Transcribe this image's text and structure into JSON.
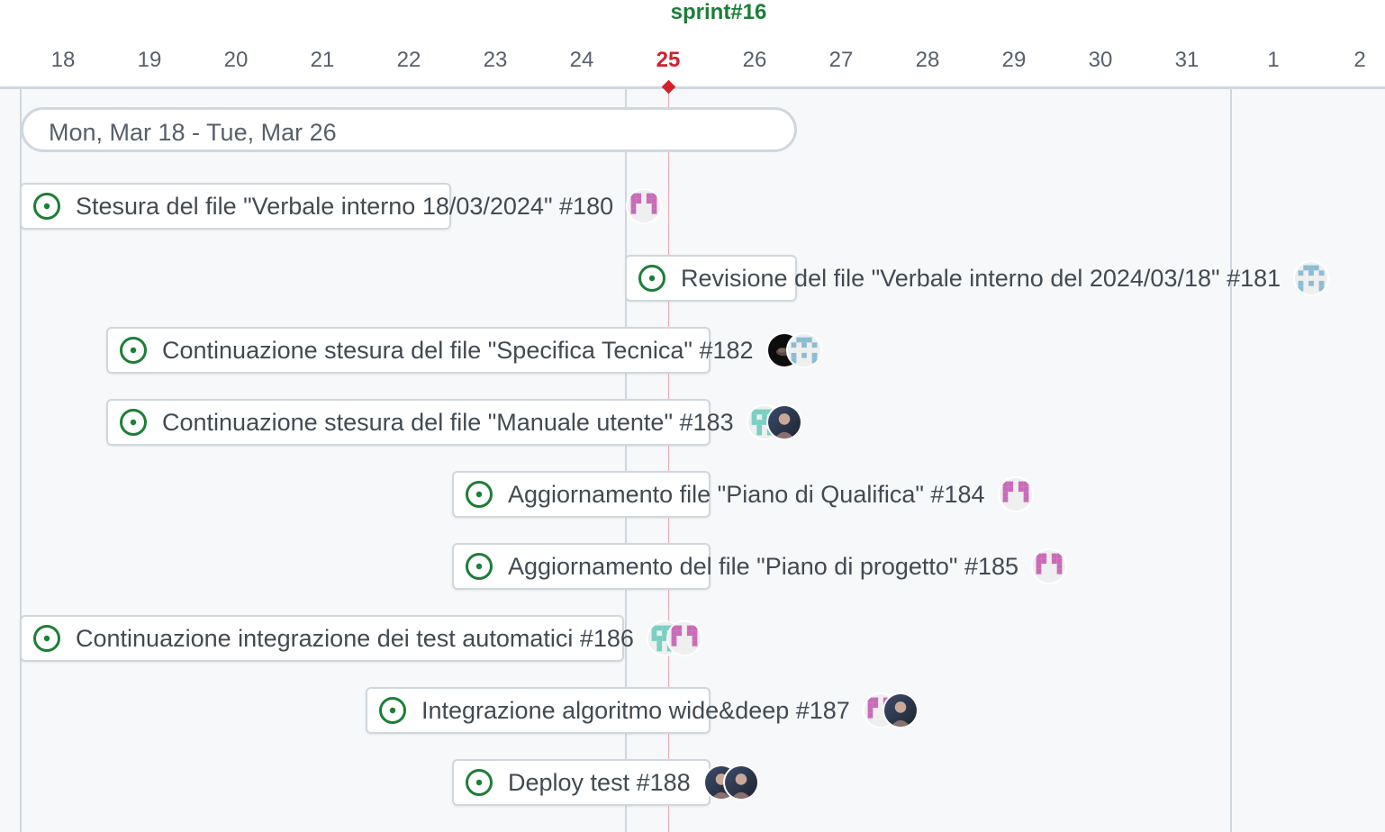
{
  "header": {
    "sprint_label": "sprint#16",
    "days": [
      "18",
      "19",
      "20",
      "21",
      "22",
      "23",
      "24",
      "25",
      "26",
      "27",
      "28",
      "29",
      "30",
      "31",
      "1",
      "2"
    ],
    "today": "25"
  },
  "iteration": {
    "label": "Mon, Mar 18 - Tue, Mar 26"
  },
  "items": [
    {
      "title": "Stesura del file \"Verbale interno 18/03/2024\" #180",
      "status": "open",
      "status_icon": "issue-opened-icon",
      "assignees": [
        "avatar-pink-identicon"
      ]
    },
    {
      "title": "Revisione del file \"Verbale interno del 2024/03/18\" #181",
      "status": "open",
      "status_icon": "issue-opened-icon",
      "assignees": [
        "avatar-blue-identicon"
      ]
    },
    {
      "title": "Continuazione stesura del file \"Specifica Tecnica\" #182",
      "status": "open",
      "status_icon": "issue-opened-icon",
      "assignees": [
        "avatar-dark-photo",
        "avatar-blue-identicon"
      ]
    },
    {
      "title": "Continuazione stesura del file \"Manuale utente\" #183",
      "status": "open",
      "status_icon": "issue-opened-icon",
      "assignees": [
        "avatar-teal-identicon",
        "avatar-portrait-photo"
      ]
    },
    {
      "title": "Aggiornamento file \"Piano di Qualifica\" #184",
      "status": "open",
      "status_icon": "issue-opened-icon",
      "assignees": [
        "avatar-pink-identicon"
      ]
    },
    {
      "title": "Aggiornamento del file \"Piano di progetto\" #185",
      "status": "open",
      "status_icon": "issue-opened-icon",
      "assignees": [
        "avatar-pink-identicon"
      ]
    },
    {
      "title": "Continuazione integrazione dei test automatici #186",
      "status": "open",
      "status_icon": "issue-opened-icon",
      "assignees": [
        "avatar-teal-identicon",
        "avatar-pink-identicon"
      ]
    },
    {
      "title": "Integrazione algoritmo wide&deep #187",
      "status": "open",
      "status_icon": "issue-opened-icon",
      "assignees": [
        "avatar-pink-identicon",
        "avatar-portrait-photo"
      ]
    },
    {
      "title": "Deploy test #188",
      "status": "open",
      "status_icon": "issue-opened-icon",
      "assignees": [
        "avatar-portrait-photo",
        "avatar-portrait-photo"
      ]
    }
  ],
  "colors": {
    "open_status": "#1a7f37",
    "today": "#cf222e",
    "sprint": "#1a7f37",
    "border": "#d0d7de",
    "background": "#f6f8fa"
  }
}
